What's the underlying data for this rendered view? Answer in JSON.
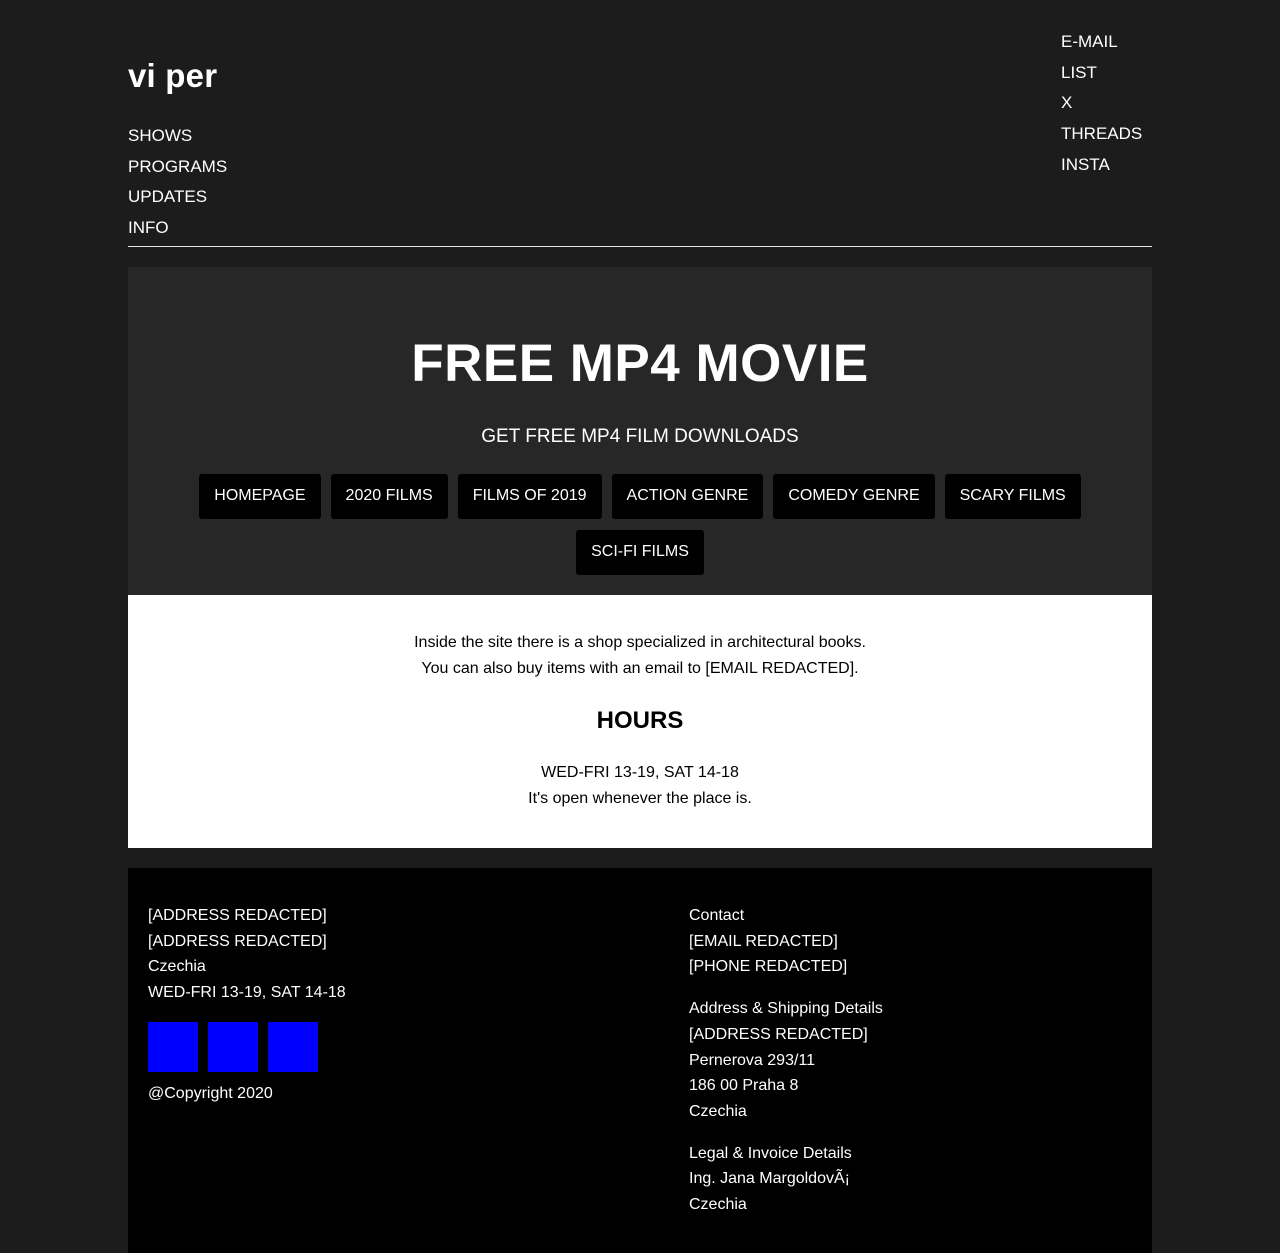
{
  "header": {
    "logo": "vi per",
    "nav": [
      "SHOWS",
      "PROGRAMS",
      "UPDATES",
      "INFO"
    ],
    "social": [
      "E-MAIL LIST",
      "X",
      "THREADS",
      "INSTA"
    ]
  },
  "hero": {
    "title": "FREE MP4 MOVIE",
    "subtitle": "GET FREE MP4 FILM DOWNLOADS",
    "buttons": [
      "HOMEPAGE",
      "2020 FILMS",
      "FILMS OF 2019",
      "ACTION GENRE",
      "COMEDY GENRE",
      "SCARY FILMS",
      "SCI-FI FILMS"
    ]
  },
  "info": {
    "line1": "Inside the site there is a shop specialized in architectural books.",
    "line2": "You can also buy items with an email to [EMAIL REDACTED].",
    "hours_heading": "HOURS",
    "hours_line1": "WED-FRI 13-19, SAT 14-18",
    "hours_line2": "It's open whenever the place is."
  },
  "footer": {
    "left": {
      "lines": [
        "[ADDRESS REDACTED]",
        "[ADDRESS REDACTED]",
        "Czechia",
        "WED-FRI 13-19, SAT 14-18"
      ],
      "copyright": "@Copyright 2020"
    },
    "contact": {
      "heading": "Contact",
      "lines": [
        "[EMAIL REDACTED]",
        "[PHONE REDACTED]"
      ]
    },
    "address": {
      "heading": "Address & Shipping Details",
      "lines": [
        "[ADDRESS REDACTED]",
        "Pernerova 293/11",
        "186 00 Praha 8",
        "Czechia"
      ]
    },
    "legal": {
      "heading": "Legal & Invoice Details",
      "lines": [
        "Ing. Jana MargoldovÃ¡",
        "Czechia"
      ]
    }
  },
  "colors": {
    "page_bg": "#1c1c1c",
    "hero_bg": "#272727",
    "button_bg": "#000000",
    "info_bg": "#ffffff",
    "footer_bg": "#000000",
    "icon_squares": "#0000ff"
  }
}
